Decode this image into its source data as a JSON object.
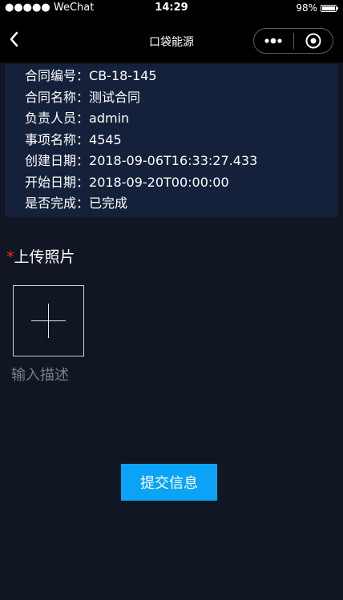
{
  "status_bar": {
    "carrier": "●●●●● WeChat",
    "time": "14:29",
    "battery": "98%",
    "battery_level": 0.98
  },
  "nav": {
    "title": "口袋能源"
  },
  "info": {
    "rows": [
      {
        "label": "合同编号：",
        "value": "CB-18-145"
      },
      {
        "label": "合同名称：",
        "value": "测试合同"
      },
      {
        "label": "负责人员：",
        "value": "admin"
      },
      {
        "label": "事项名称：",
        "value": "4545"
      },
      {
        "label": "创建日期：",
        "value": "2018-09-06T16:33:27.433"
      },
      {
        "label": "开始日期：",
        "value": "2018-09-20T00:00:00"
      },
      {
        "label": "是否完成：",
        "value": "已完成"
      }
    ]
  },
  "upload": {
    "required_mark": "*",
    "title": "上传照片",
    "description_placeholder": "输入描述"
  },
  "submit_label": "提交信息",
  "colors": {
    "background": "#101622",
    "info_panel": "#15203a",
    "accent": "#0aa3f5",
    "required": "#ff2222"
  }
}
